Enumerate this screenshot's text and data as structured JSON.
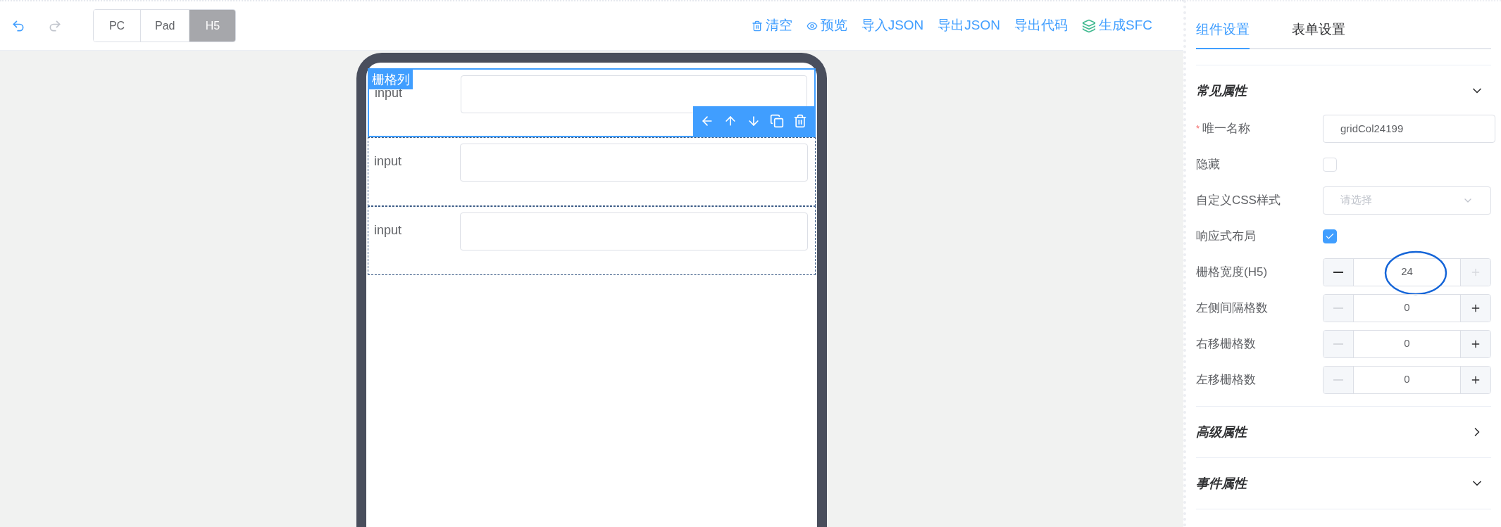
{
  "toolbar": {
    "undo": {
      "disabled": false
    },
    "redo": {
      "disabled": true
    },
    "devices": [
      {
        "label": "PC",
        "selected": false
      },
      {
        "label": "Pad",
        "selected": false
      },
      {
        "label": "H5",
        "selected": true
      }
    ],
    "actions": [
      {
        "kind": "trash",
        "label": "清空"
      },
      {
        "kind": "eye",
        "label": "预览"
      },
      {
        "kind": "none",
        "label": "导入JSON"
      },
      {
        "kind": "none",
        "label": "导出JSON"
      },
      {
        "kind": "none",
        "label": "导出代码"
      },
      {
        "kind": "layers",
        "label": "生成SFC"
      }
    ]
  },
  "canvas": {
    "rows": [
      {
        "label": "input",
        "selected": true,
        "tag": "栅格列"
      },
      {
        "label": "input",
        "selected": false
      },
      {
        "label": "input",
        "selected": false
      }
    ]
  },
  "panel": {
    "tabs": [
      {
        "label": "组件设置",
        "selected": true
      },
      {
        "label": "表单设置",
        "selected": false
      }
    ],
    "sections": [
      {
        "title": "常见属性",
        "expanded": true,
        "fields": [
          {
            "kind": "text",
            "label": "唯一名称",
            "required_mark": "*",
            "value": "gridCol24199"
          },
          {
            "kind": "checkbox",
            "label": "隐藏",
            "checked": false
          },
          {
            "kind": "select",
            "label": "自定义CSS样式",
            "placeholder": "请选择"
          },
          {
            "kind": "checkbox",
            "label": "响应式布局",
            "checked": true
          },
          {
            "kind": "stepper",
            "label": "栅格宽度(H5)",
            "value": "24",
            "minus_disabled": false,
            "plus_disabled": true,
            "circled": true
          },
          {
            "kind": "stepper",
            "label": "左侧间隔格数",
            "value": "0",
            "minus_disabled": true,
            "plus_disabled": false
          },
          {
            "kind": "stepper",
            "label": "右移栅格数",
            "value": "0",
            "minus_disabled": true,
            "plus_disabled": false
          },
          {
            "kind": "stepper",
            "label": "左移栅格数",
            "value": "0",
            "minus_disabled": true,
            "plus_disabled": false
          }
        ]
      },
      {
        "title": "高级属性",
        "expanded": false
      },
      {
        "title": "事件属性",
        "expanded": true
      }
    ]
  }
}
